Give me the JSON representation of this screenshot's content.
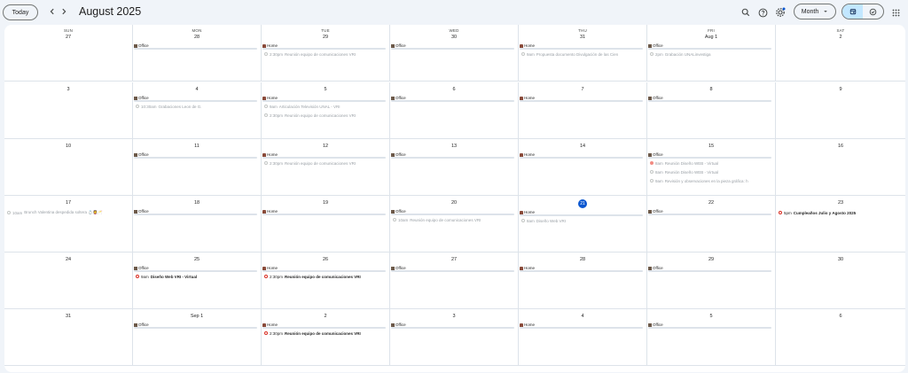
{
  "toolbar": {
    "today_label": "Today",
    "prev_icon": "chevron-left-icon",
    "next_icon": "chevron-right-icon",
    "title": "August 2025",
    "view_label": "Month"
  },
  "weekdays": [
    "SUN",
    "MON",
    "TUE",
    "WED",
    "THU",
    "FRI",
    "SAT"
  ],
  "weeks": [
    {
      "days": [
        {
          "num": "27",
          "wl": null,
          "events": []
        },
        {
          "num": "28",
          "wl": "Office",
          "events": []
        },
        {
          "num": "29",
          "wl": "Home",
          "events": [
            {
              "time": "2:30pm",
              "title": "Reunión equipo de comunicaciones VRI",
              "past": true
            }
          ]
        },
        {
          "num": "30",
          "wl": "Office",
          "events": []
        },
        {
          "num": "31",
          "wl": "Home",
          "events": [
            {
              "time": "9am",
              "title": "Propuesta documento Divulgación de las Cien",
              "past": true
            }
          ]
        },
        {
          "num": "Aug 1",
          "wl": "Office",
          "events": [
            {
              "time": "2pm",
              "title": "Grabación UNALinvestiga",
              "past": true
            }
          ]
        },
        {
          "num": "2",
          "wl": null,
          "events": []
        }
      ]
    },
    {
      "days": [
        {
          "num": "3",
          "wl": null,
          "events": []
        },
        {
          "num": "4",
          "wl": "Office",
          "events": [
            {
              "time": "10:30am",
              "title": "Grabaciones Leon de G.",
              "past": true
            }
          ]
        },
        {
          "num": "5",
          "wl": "Home",
          "events": [
            {
              "time": "9am",
              "title": "Articulación Televisión UNAL - VRI",
              "past": true
            },
            {
              "time": "2:30pm",
              "title": "Reunión equipo de comunicaciones VRI",
              "past": true
            }
          ]
        },
        {
          "num": "6",
          "wl": "Office",
          "events": []
        },
        {
          "num": "7",
          "wl": "Home",
          "events": []
        },
        {
          "num": "8",
          "wl": "Office",
          "events": []
        },
        {
          "num": "9",
          "wl": null,
          "events": []
        }
      ]
    },
    {
      "days": [
        {
          "num": "10",
          "wl": null,
          "events": []
        },
        {
          "num": "11",
          "wl": "Office",
          "events": []
        },
        {
          "num": "12",
          "wl": "Home",
          "events": [
            {
              "time": "2:30pm",
              "title": "Reunión equipo de comunicaciones VRI",
              "past": true
            }
          ]
        },
        {
          "num": "13",
          "wl": "Office",
          "events": []
        },
        {
          "num": "14",
          "wl": "Home",
          "events": []
        },
        {
          "num": "15",
          "wl": "Office",
          "events": [
            {
              "time": "8am",
              "title": "Reunión Diseño WEB - Virtual",
              "past": true,
              "filled": true
            },
            {
              "time": "8am",
              "title": "Reunión Diseño WEB - Virtual",
              "past": true
            },
            {
              "time": "9am",
              "title": "Revisión y observaciones en la pieza gráfica: h",
              "past": true
            }
          ]
        },
        {
          "num": "16",
          "wl": null,
          "events": []
        }
      ]
    },
    {
      "days": [
        {
          "num": "17",
          "wl": null,
          "events": [
            {
              "time": "10am",
              "title": "Brunch Valentina despedida soltera 💍👰🥂",
              "past": true
            }
          ]
        },
        {
          "num": "18",
          "wl": "Office",
          "events": []
        },
        {
          "num": "19",
          "wl": "Home",
          "events": []
        },
        {
          "num": "20",
          "wl": "Office",
          "events": [
            {
              "time": "10am",
              "title": "Reunión equipo de comunicaciones VRI",
              "past": true
            }
          ]
        },
        {
          "num": "21",
          "today": true,
          "wl": "Home",
          "events": [
            {
              "time": "8am",
              "title": "Diseño Web VRI",
              "past": true
            }
          ]
        },
        {
          "num": "22",
          "wl": "Office",
          "events": []
        },
        {
          "num": "23",
          "wl": null,
          "events": [
            {
              "time": "5pm",
              "title": "Cumpleaños Julio y Agosto 2025",
              "past": false
            }
          ]
        }
      ]
    },
    {
      "days": [
        {
          "num": "24",
          "wl": null,
          "events": []
        },
        {
          "num": "25",
          "wl": "Office",
          "events": [
            {
              "time": "9am",
              "title": "Diseño Web VRI - Virtual",
              "past": false
            }
          ]
        },
        {
          "num": "26",
          "wl": "Home",
          "events": [
            {
              "time": "2:30pm",
              "title": "Reunión equipo de comunicaciones VRI",
              "past": false
            }
          ]
        },
        {
          "num": "27",
          "wl": "Office",
          "events": []
        },
        {
          "num": "28",
          "wl": "Home",
          "events": []
        },
        {
          "num": "29",
          "wl": "Office",
          "events": []
        },
        {
          "num": "30",
          "wl": null,
          "events": []
        }
      ]
    },
    {
      "days": [
        {
          "num": "31",
          "wl": null,
          "events": []
        },
        {
          "num": "Sep 1",
          "wl": "Office",
          "events": []
        },
        {
          "num": "2",
          "wl": "Home",
          "events": [
            {
              "time": "2:30pm",
              "title": "Reunión equipo de comunicaciones VRI",
              "past": false
            }
          ]
        },
        {
          "num": "3",
          "wl": "Office",
          "events": []
        },
        {
          "num": "4",
          "wl": "Home",
          "events": []
        },
        {
          "num": "5",
          "wl": "Office",
          "events": []
        },
        {
          "num": "6",
          "wl": null,
          "events": []
        }
      ]
    }
  ],
  "colors": {
    "accent": "#0b57d0",
    "event_ring": "#d93025",
    "selected_view": "#c2e7ff",
    "background": "#f0f4f9"
  }
}
